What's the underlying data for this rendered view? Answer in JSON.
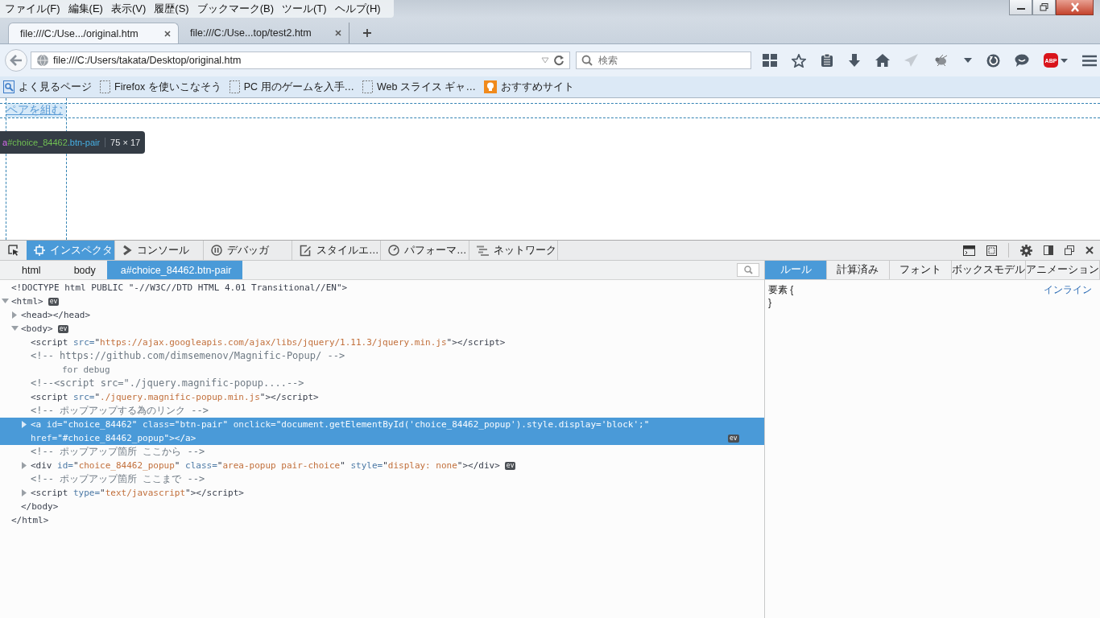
{
  "menu": [
    {
      "label": "ファイル(F)"
    },
    {
      "label": "編集(E)"
    },
    {
      "label": "表示(V)"
    },
    {
      "label": "履歴(S)"
    },
    {
      "label": "ブックマーク(B)"
    },
    {
      "label": "ツール(T)"
    },
    {
      "label": "ヘルプ(H)"
    }
  ],
  "tabs": [
    {
      "title": "file:///C:/Use.../original.htm",
      "selected": true
    },
    {
      "title": "file:///C:/Use...top/test2.htm",
      "selected": false
    }
  ],
  "address": {
    "url": "file:///C:/Users/takata/Desktop/original.htm"
  },
  "search": {
    "placeholder": "検索"
  },
  "toolbar": {
    "abp_badge": "ABP"
  },
  "bookmarks": [
    {
      "label": "よく見るページ",
      "kind": "smart"
    },
    {
      "label": "Firefox を使いこなそう",
      "kind": "page"
    },
    {
      "label": "PC 用のゲームを入手…",
      "kind": "page"
    },
    {
      "label": "Web スライス ギャ…",
      "kind": "page"
    },
    {
      "label": "おすすめサイト",
      "kind": "suggest"
    }
  ],
  "page": {
    "link": "ペアを組む",
    "tooltip": {
      "tag": "a",
      "id": "#choice_84462",
      "class": ".btn-pair",
      "size": "75 × 17"
    }
  },
  "devtools_tabs": [
    {
      "label": "インスペクタ",
      "kind": "inspector",
      "selected": true
    },
    {
      "label": "コンソール",
      "kind": "console",
      "selected": false
    },
    {
      "label": "デバッガ",
      "kind": "debugger",
      "selected": false
    },
    {
      "label": "スタイルエ…",
      "kind": "style",
      "selected": false
    },
    {
      "label": "パフォーマ…",
      "kind": "performance",
      "selected": false
    },
    {
      "label": "ネットワーク",
      "kind": "network",
      "selected": false
    }
  ],
  "breadcrumbs": [
    {
      "label": "html",
      "selected": false
    },
    {
      "label": "body",
      "selected": false
    },
    {
      "label": "a#choice_84462.btn-pair",
      "selected": true
    }
  ],
  "markup": [
    {
      "kind": "doctype",
      "selected": false,
      "text": "<!DOCTYPE html PUBLIC \"-//W3C//DTD HTML 4.01 Transitional//EN\">"
    },
    {
      "kind": "element",
      "selected": false,
      "expanded": true,
      "badge": "ev",
      "parts": [
        {
          "kind": "tag",
          "text": "<html>"
        }
      ],
      "close": "</html>",
      "children": [
        {
          "kind": "element",
          "selected": false,
          "expanded": false,
          "parts": [
            {
              "kind": "tag",
              "text": "<head></head>"
            }
          ]
        },
        {
          "kind": "element",
          "selected": false,
          "expanded": true,
          "badge": "ev",
          "parts": [
            {
              "kind": "tag",
              "text": "<body>"
            }
          ],
          "close": "</body>",
          "children": [
            {
              "kind": "element",
              "selected": false,
              "parts": [
                {
                  "kind": "tag",
                  "text": "<script"
                },
                {
                  "kind": "attr",
                  "text": " src="
                },
                {
                  "kind": "tag",
                  "text": "\""
                },
                {
                  "kind": "val",
                  "text": "https://ajax.googleapis.com/ajax/libs/jquery/1.11.3/jquery.min.js"
                },
                {
                  "kind": "tag",
                  "text": "\"></script>"
                }
              ]
            },
            {
              "kind": "comment",
              "selected": false,
              "text": "<!-- https://github.com/dimsemenov/Magnific-Popup/ -->"
            },
            {
              "kind": "text",
              "selected": false,
              "text": "for debug"
            },
            {
              "kind": "comment",
              "selected": false,
              "text": "<!--<script src=\"./jquery.magnific-popup....-->"
            },
            {
              "kind": "element",
              "selected": false,
              "parts": [
                {
                  "kind": "tag",
                  "text": "<script"
                },
                {
                  "kind": "attr",
                  "text": " src="
                },
                {
                  "kind": "tag",
                  "text": "\""
                },
                {
                  "kind": "val",
                  "text": "./jquery.magnific-popup.min.js"
                },
                {
                  "kind": "tag",
                  "text": "\"></script>"
                }
              ]
            },
            {
              "kind": "comment",
              "selected": false,
              "text": "<!-- ポップアップする為のリンク -->"
            },
            {
              "kind": "element",
              "selected": true,
              "expanded": false,
              "badge": "ev",
              "parts": [
                {
                  "kind": "tag",
                  "text": "<a"
                },
                {
                  "kind": "attr",
                  "text": " id="
                },
                {
                  "kind": "tag",
                  "text": "\""
                },
                {
                  "kind": "val",
                  "text": "choice_84462"
                },
                {
                  "kind": "tag",
                  "text": "\""
                },
                {
                  "kind": "attr",
                  "text": " class="
                },
                {
                  "kind": "tag",
                  "text": "\""
                },
                {
                  "kind": "val",
                  "text": "btn-pair"
                },
                {
                  "kind": "tag",
                  "text": "\""
                },
                {
                  "kind": "attr",
                  "text": " onclick="
                },
                {
                  "kind": "tag",
                  "text": "\""
                },
                {
                  "kind": "val",
                  "text": "document.getElementById('choice_84462_popup').style.display='block';"
                },
                {
                  "kind": "tag",
                  "text": "\""
                },
                {
                  "kind": "attr",
                  "text": " href="
                },
                {
                  "kind": "tag",
                  "text": "\""
                },
                {
                  "kind": "val",
                  "text": "#choice_84462_popup"
                },
                {
                  "kind": "tag",
                  "text": "\"></a>"
                }
              ]
            },
            {
              "kind": "comment",
              "selected": false,
              "text": "<!-- ポップアップ箇所 ここから -->"
            },
            {
              "kind": "element",
              "selected": false,
              "expanded": false,
              "badge": "ev",
              "parts": [
                {
                  "kind": "tag",
                  "text": "<div"
                },
                {
                  "kind": "attr",
                  "text": " id="
                },
                {
                  "kind": "tag",
                  "text": "\""
                },
                {
                  "kind": "val",
                  "text": "choice_84462_popup"
                },
                {
                  "kind": "tag",
                  "text": "\""
                },
                {
                  "kind": "attr",
                  "text": " class="
                },
                {
                  "kind": "tag",
                  "text": "\""
                },
                {
                  "kind": "val",
                  "text": "area-popup pair-choice"
                },
                {
                  "kind": "tag",
                  "text": "\""
                },
                {
                  "kind": "attr",
                  "text": " style="
                },
                {
                  "kind": "tag",
                  "text": "\""
                },
                {
                  "kind": "val",
                  "text": "display: none"
                },
                {
                  "kind": "tag",
                  "text": "\"></div>"
                }
              ]
            },
            {
              "kind": "comment",
              "selected": false,
              "text": "<!-- ポップアップ箇所 ここまで -->"
            },
            {
              "kind": "element",
              "selected": false,
              "expanded": false,
              "parts": [
                {
                  "kind": "tag",
                  "text": "<script"
                },
                {
                  "kind": "attr",
                  "text": " type="
                },
                {
                  "kind": "tag",
                  "text": "\""
                },
                {
                  "kind": "val",
                  "text": "text/javascript"
                },
                {
                  "kind": "tag",
                  "text": "\"></script>"
                }
              ]
            }
          ]
        }
      ]
    }
  ],
  "sidebar_tabs": [
    {
      "label": "ルール",
      "selected": true
    },
    {
      "label": "計算済み",
      "selected": false
    },
    {
      "label": "フォント",
      "selected": false
    },
    {
      "label": "ボックスモデル",
      "selected": false
    },
    {
      "label": "アニメーション",
      "selected": false
    }
  ],
  "rule": {
    "selector": "要素",
    "open": "{",
    "close": "}",
    "source": "インライン"
  }
}
